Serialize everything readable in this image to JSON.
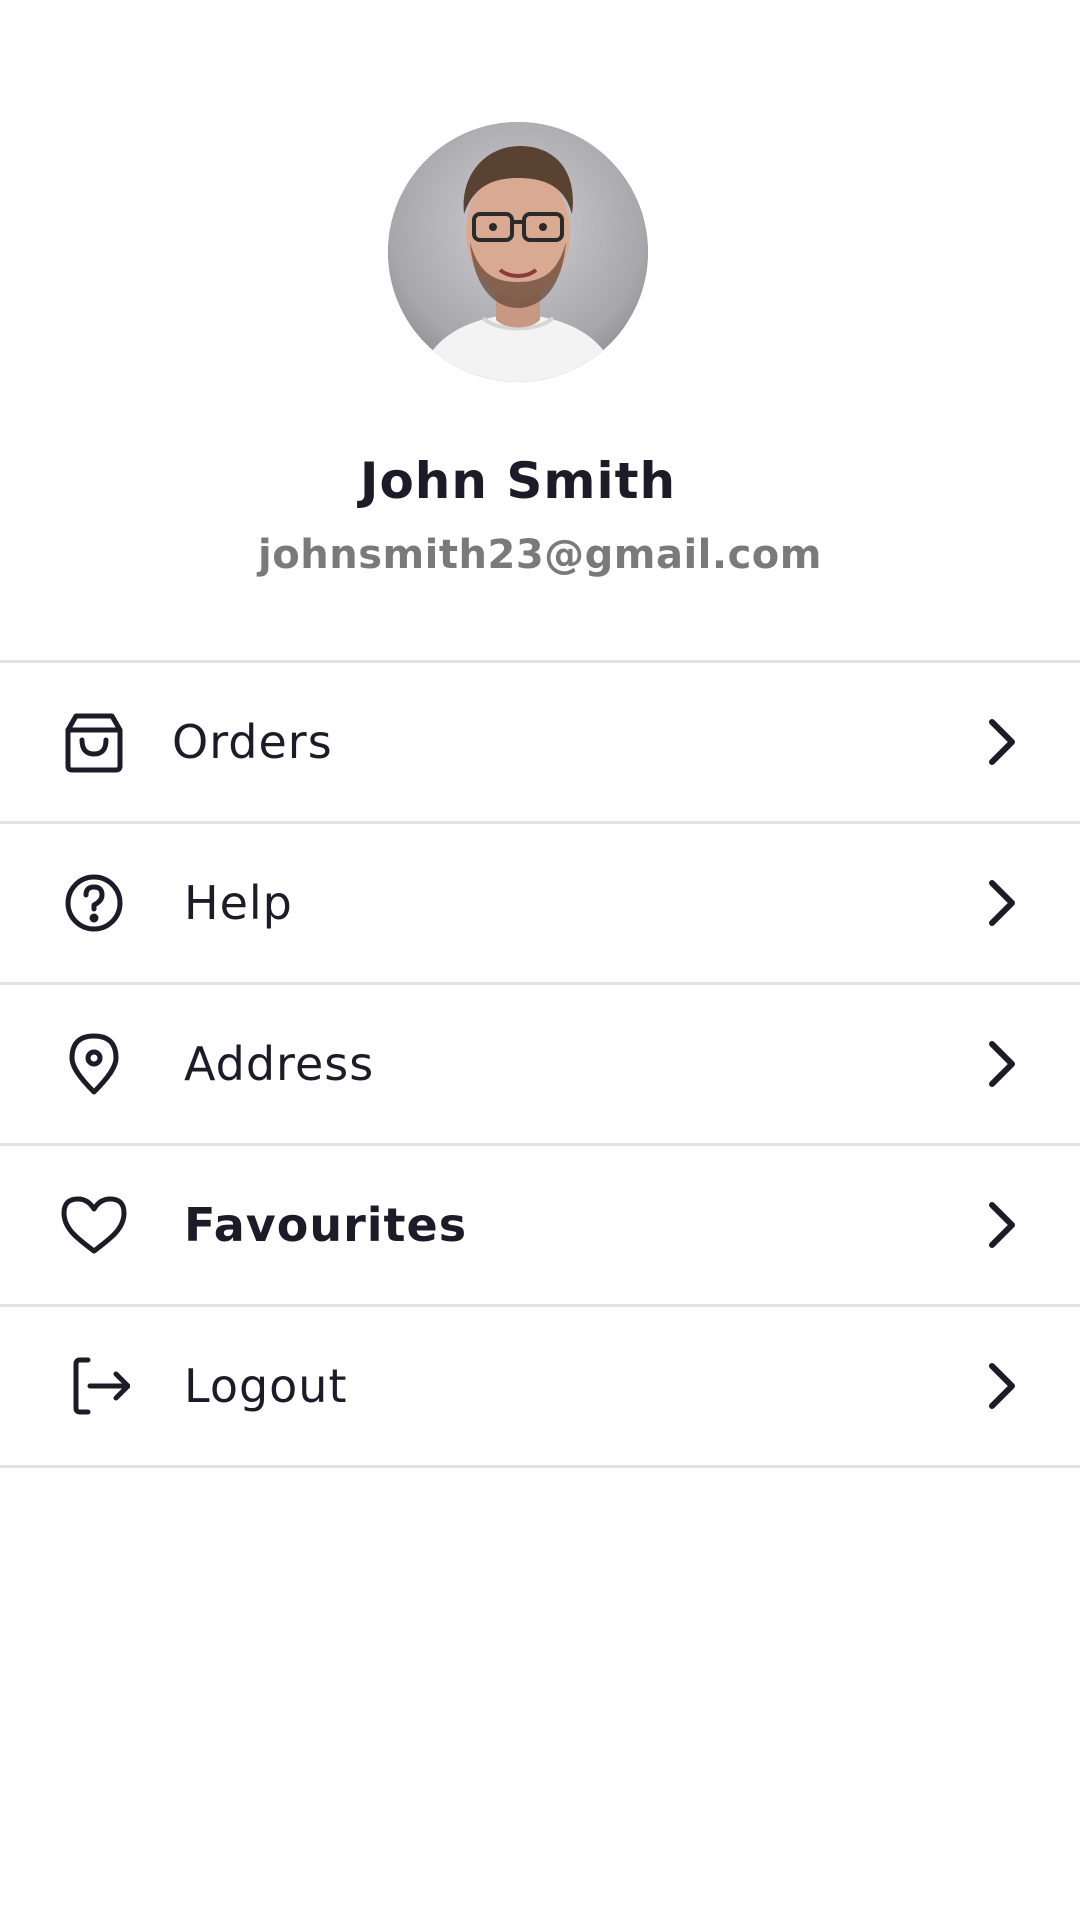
{
  "profile": {
    "name": "John Smith",
    "email": "johnsmith23@gmail.com"
  },
  "menu": {
    "items": [
      {
        "label": "Orders",
        "icon": "shopping-bag-icon"
      },
      {
        "label": "Help",
        "icon": "help-circle-icon"
      },
      {
        "label": "Address",
        "icon": "map-pin-icon"
      },
      {
        "label": "Favourites",
        "icon": "heart-icon"
      },
      {
        "label": "Logout",
        "icon": "logout-icon"
      }
    ]
  },
  "colors": {
    "text": "#1e1b28",
    "secondary_text": "#7a7a7a",
    "divider": "#e3e3e3",
    "background": "#ffffff"
  }
}
